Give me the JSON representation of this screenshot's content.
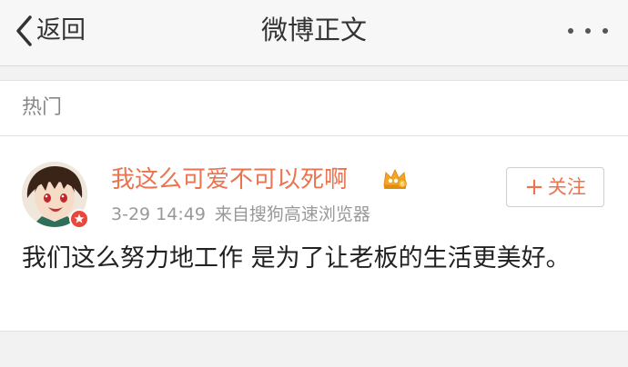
{
  "navbar": {
    "back_label": "返回",
    "title": "微博正文"
  },
  "section": {
    "label": "热门"
  },
  "post": {
    "username": "我这么可爱不可以死啊",
    "date": "3-29 14:49",
    "source": "来自搜狗高速浏览器",
    "follow_label": "关注",
    "follow_plus": "+",
    "text": "我们这么努力地工作 是为了让老板的生活更美好。"
  },
  "colors": {
    "accent": "#eb7350",
    "text_primary": "#222222",
    "text_secondary": "#999999",
    "background": "#f2f2f2"
  },
  "icons": {
    "back": "chevron-left-icon",
    "more": "more-dots-icon",
    "crown": "crown-badge-icon",
    "verify": "verified-badge-icon"
  }
}
